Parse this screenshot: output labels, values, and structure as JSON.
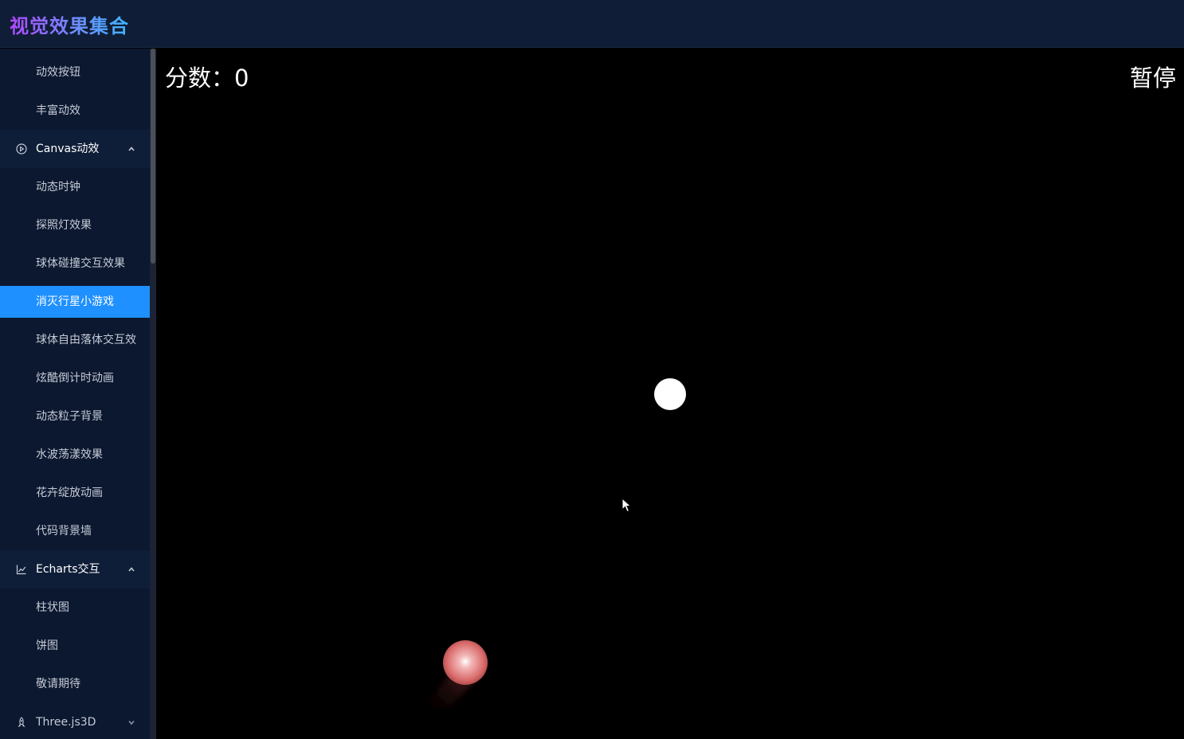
{
  "header": {
    "title": "视觉效果集合"
  },
  "sidebar": {
    "items_top": [
      "动效按钮",
      "丰富动效"
    ],
    "canvas_group": {
      "title": "Canvas动效",
      "icon": "play-circle-icon",
      "items": [
        "动态时钟",
        "探照灯效果",
        "球体碰撞交互效果",
        "消灭行星小游戏",
        "球体自由落体交互效",
        "炫酷倒计时动画",
        "动态粒子背景",
        "水波荡漾效果",
        "花卉绽放动画",
        "代码背景墙"
      ],
      "active_item": "消灭行星小游戏"
    },
    "echarts_group": {
      "title": "Echarts交互",
      "icon": "line-chart-icon",
      "items": [
        "柱状图",
        "饼图",
        "敬请期待"
      ]
    },
    "three_group": {
      "title": "Three.js3D",
      "icon": "rocket-icon"
    }
  },
  "game": {
    "score_label": "分数：",
    "score_value": "0",
    "pause_label": "暂停"
  },
  "colors": {
    "active_menu": "#1e90ff",
    "sidebar_bg": "#0c1830",
    "header_bg": "#0f1d36",
    "planet": "#ffffff",
    "player": "#e07a7a"
  }
}
